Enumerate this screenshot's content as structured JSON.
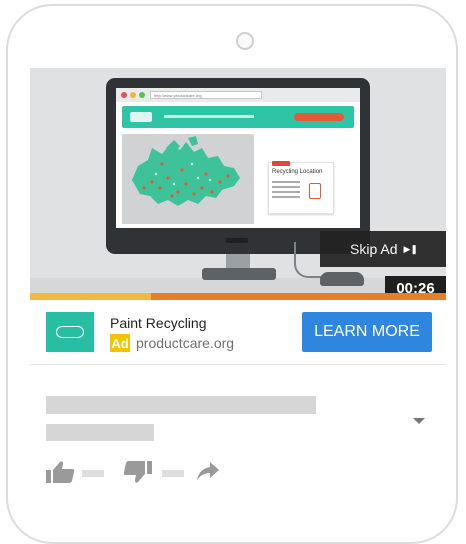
{
  "player": {
    "browser_url": "http://www.productcare.org",
    "card_title": "Recycling Location",
    "skip_label": "Skip Ad",
    "skip_icon": "skip-next-icon",
    "time_remaining": "00:26",
    "progress_fraction": 0.29
  },
  "ad": {
    "logo_icon": "productcare-logo",
    "title": "Paint Recycling",
    "badge": "Ad",
    "domain": "productcare.org",
    "cta_label": "LEARN MORE"
  },
  "video_meta": {
    "expand_icon": "chevron-down-icon",
    "like_icon": "thumb-up-icon",
    "dislike_icon": "thumb-down-icon",
    "share_icon": "share-icon"
  },
  "colors": {
    "accent_teal": "#28bea3",
    "cta_blue": "#2e86de",
    "ad_badge_yellow": "#f3c400",
    "progress_orange": "#e87d2a",
    "progress_played": "#f3b742"
  }
}
